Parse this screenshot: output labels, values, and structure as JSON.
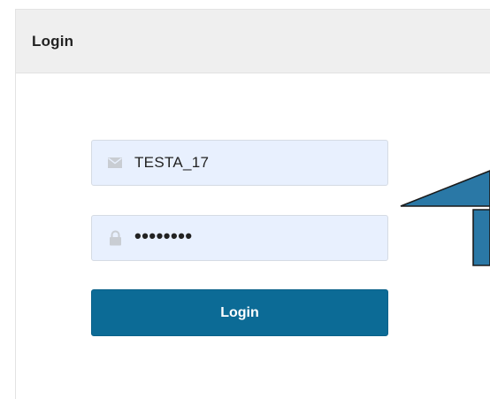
{
  "panel": {
    "title": "Login"
  },
  "form": {
    "username": {
      "icon": "envelope-icon",
      "value": "TESTA_17"
    },
    "password": {
      "icon": "lock-icon",
      "value": "••••••••"
    },
    "login_label": "Login"
  },
  "annotation": {
    "icon": "callout-arrow",
    "fill": "#2a78a6",
    "stroke": "#1b1b1b"
  },
  "colors": {
    "header_bg": "#efefef",
    "field_bg": "#e8f0fe",
    "button_bg": "#0c6b96"
  }
}
